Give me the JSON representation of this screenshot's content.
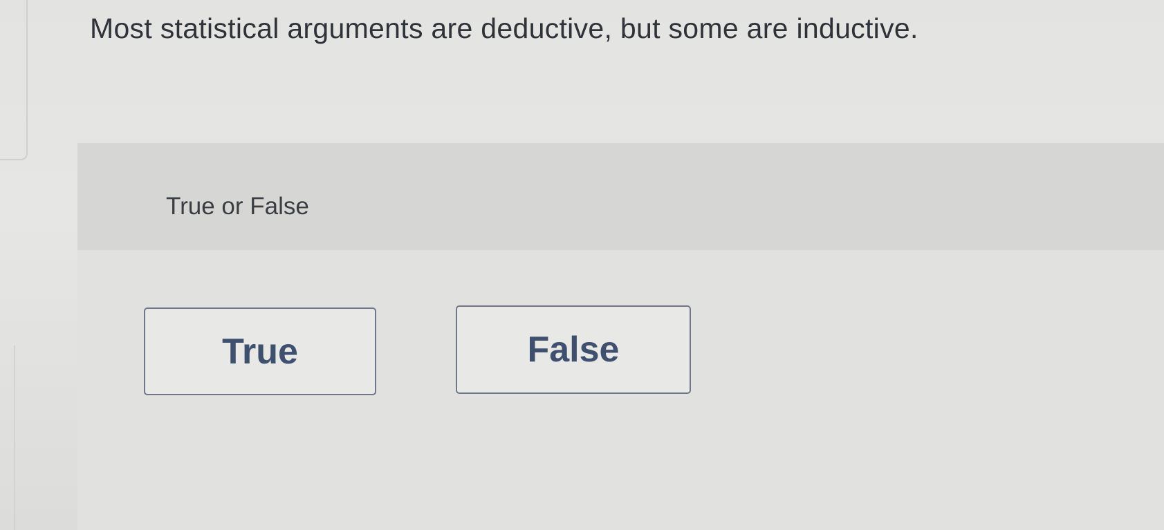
{
  "question": {
    "text": "Most statistical arguments are deductive, but some are inductive."
  },
  "answer": {
    "type_label": "True or False",
    "choices": [
      {
        "label": "True"
      },
      {
        "label": "False"
      }
    ]
  },
  "colors": {
    "background": "#e3e3e1",
    "button_border": "#6f7786",
    "button_text": "#3f4f6e",
    "question_text": "#2f3238"
  }
}
